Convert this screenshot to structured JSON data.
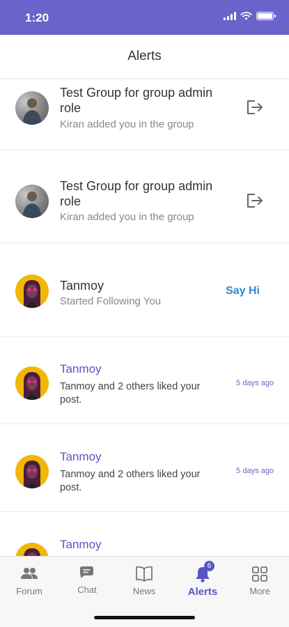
{
  "status_bar": {
    "time": "1:20"
  },
  "header": {
    "title": "Alerts"
  },
  "alerts": [
    {
      "type": "group",
      "title": "Test Group for group admin role",
      "subtitle": "Kiran added you in the group",
      "action_icon": "exit-icon"
    },
    {
      "type": "group",
      "title": "Test Group for group admin role",
      "subtitle": "Kiran added you in the group",
      "action_icon": "exit-icon"
    },
    {
      "type": "follow",
      "title": "Tanmoy",
      "subtitle": "Started Following You",
      "action_label": "Say Hi"
    },
    {
      "type": "like",
      "title": "Tanmoy",
      "subtitle": "Tanmoy  and 2 others liked your post.",
      "time": "5 days ago"
    },
    {
      "type": "like",
      "title": "Tanmoy",
      "subtitle": "Tanmoy  and 2 others liked your post.",
      "time": "5 days ago"
    },
    {
      "type": "like",
      "title": "Tanmoy",
      "subtitle": "",
      "time": ""
    }
  ],
  "bottom_nav": {
    "items": [
      {
        "label": "Forum",
        "icon": "people-icon"
      },
      {
        "label": "Chat",
        "icon": "chat-icon"
      },
      {
        "label": "News",
        "icon": "book-icon"
      },
      {
        "label": "Alerts",
        "icon": "bell-icon",
        "badge": "6",
        "active": true
      },
      {
        "label": "More",
        "icon": "grid-icon"
      }
    ]
  },
  "colors": {
    "accent": "#6a63c9",
    "link": "#2b8ad6",
    "title_purple": "#5a55c2"
  }
}
